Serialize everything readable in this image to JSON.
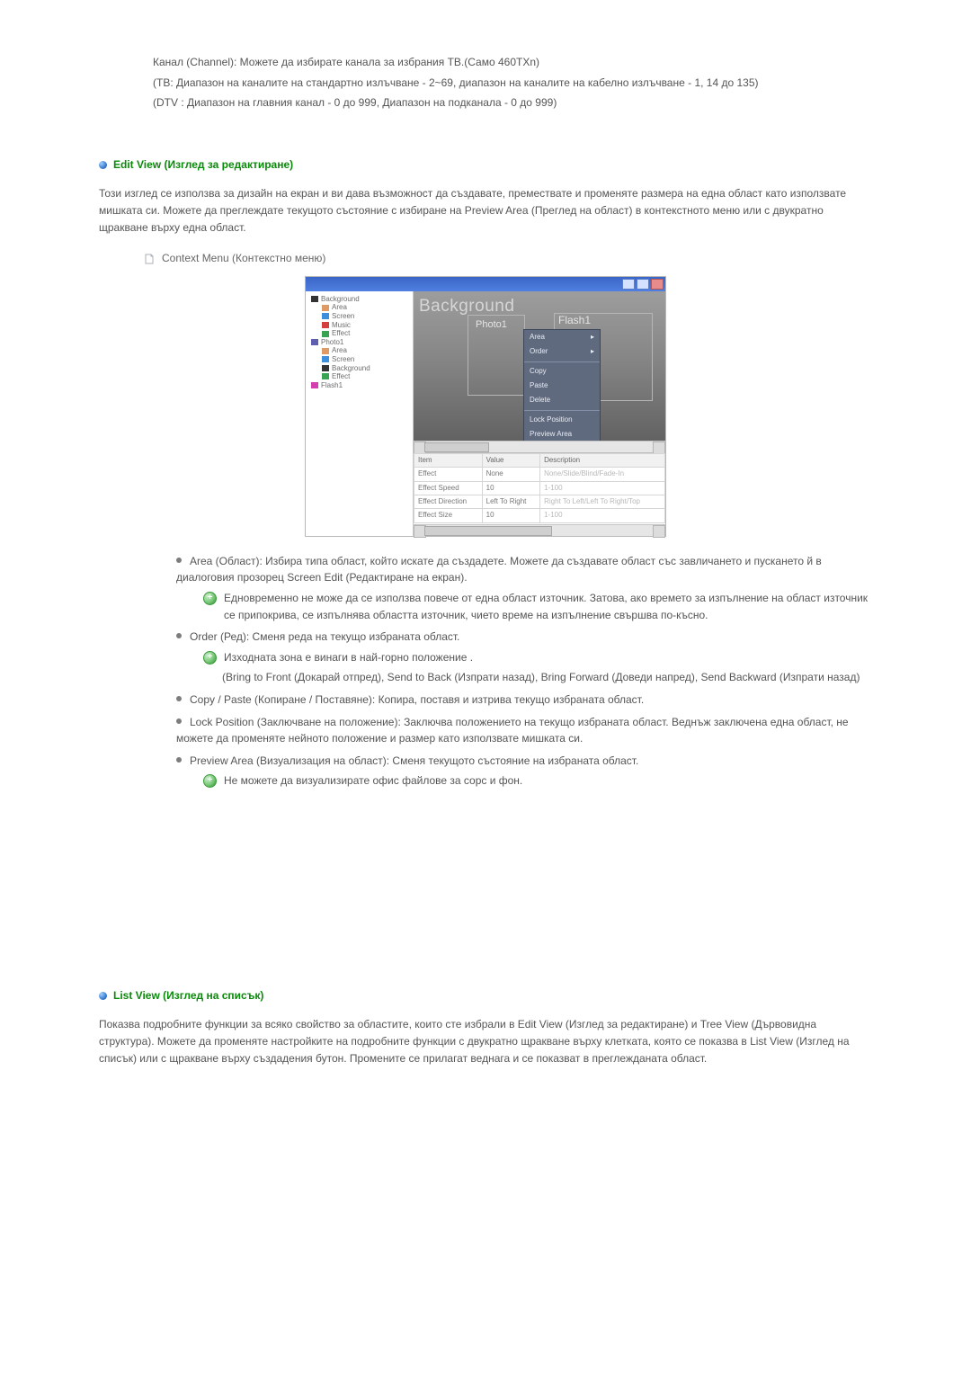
{
  "top_paras": [
    "Канал (Channel): Можете да избирате канала за избрания ТВ.(Само 460TXn)",
    "(ТВ: Диапазон на каналите на стандартно излъчване - 2~69, диапазон на каналите на кабелно излъчване - 1, 14 до 135)",
    "(DTV : Диапазон на главния канал - 0 до 999, Диапазон на подканала - 0 до 999)"
  ],
  "edit_view": {
    "title": "Edit View (Изглед за редактиране)",
    "intro": "Този изглед се използва за дизайн на екран и ви дава възможност да създавате, премествате и променяте размера на една област като използвате мишката си. Можете да преглеждате текущото състояние с избиране на Preview Area (Преглед на област) в контекстното меню или с двукратно щракване върху една област.",
    "sub_title": "Context Menu (Контекстно меню)"
  },
  "figure": {
    "canvas_title": "Background",
    "photo_label": "Photo1",
    "flash_label": "Flash1",
    "tree": [
      {
        "ind": 0,
        "icon": "ico-bg",
        "label": "Background"
      },
      {
        "ind": 1,
        "icon": "ico-area",
        "label": "Area"
      },
      {
        "ind": 1,
        "icon": "ico-screen",
        "label": "Screen"
      },
      {
        "ind": 1,
        "icon": "ico-music",
        "label": "Music"
      },
      {
        "ind": 1,
        "icon": "ico-effect",
        "label": "Effect"
      },
      {
        "ind": 0,
        "icon": "ico-photos",
        "label": "Photo1"
      },
      {
        "ind": 1,
        "icon": "ico-area",
        "label": "Area"
      },
      {
        "ind": 1,
        "icon": "ico-screen",
        "label": "Screen"
      },
      {
        "ind": 1,
        "icon": "ico-bg",
        "label": "Background"
      },
      {
        "ind": 1,
        "icon": "ico-effect",
        "label": "Effect"
      },
      {
        "ind": 0,
        "icon": "ico-pwsh",
        "label": "Flash1"
      }
    ],
    "ctx_menu": {
      "area": "Area",
      "order": "Order",
      "copy": "Copy",
      "paste": "Paste",
      "delete": "Delete",
      "lock": "Lock Position",
      "preview": "Preview Area"
    },
    "table": {
      "cols": [
        "Item",
        "Value",
        "Description"
      ],
      "rows": [
        [
          "Effect",
          "None",
          "None/Slide/Blind/Fade-In"
        ],
        [
          "Effect Speed",
          "10",
          "1-100"
        ],
        [
          "Effect Direction",
          "Left To Right",
          "Right To Left/Left To Right/Top"
        ],
        [
          "Effect Size",
          "10",
          "1-100"
        ]
      ]
    }
  },
  "edit_items": [
    {
      "head": "Area (Област):",
      "text": " Избира типа област, който искате да създадете. Можете да създавате област със завличането и пускането й в диалоговия прозорец Screen Edit (Редактиране на екран).",
      "notes": [
        "Едновременно не може да се използва повече от една област източник. Затова, ако времето за изпълнение на област източник се припокрива, се изпълнява областта източник, чието време на изпълнение свършва по-късно."
      ]
    },
    {
      "head": "Order (Ред):",
      "text": " Сменя реда на текущо избраната област.",
      "notes": [
        "Изходната зона е винаги в най-горно положение .",
        "(Bring to Front (Докарай отпред), Send to Back (Изпрати назад), Bring Forward (Доведи напред), Send Backward (Изпрати назад)"
      ],
      "second_note_plain": true
    },
    {
      "head": "Copy / Paste (Копиране / Поставяне):",
      "text": " Копира, поставя и изтрива текущо избраната област."
    },
    {
      "head": "Lock Position (Заключване на положение):",
      "text": " Заключва положението на текущо избраната област. Веднъж заключена една област, не можете да променяте нейното положение и размер като използвате мишката си."
    },
    {
      "head": "Preview Area (Визуализация на област):",
      "text": " Сменя текущото състояние на избраната област.",
      "notes": [
        "Не можете да визуализирате офис файлове за сорс и фон."
      ]
    }
  ],
  "list_view": {
    "title": "List View (Изглед на списък)",
    "intro": "Показва подробните функции за всяко свойство за областите, които сте избрали в Edit View (Изглед за редактиране) и Tree View (Дървовидна структура). Можете да променяте настройките на подробните функции с двукратно щракване върху клетката, която се показва в List View (Изглед на списък) или с щракване върху създадения бутон. Промените се прилагат веднага и се показват в преглежданата област."
  }
}
